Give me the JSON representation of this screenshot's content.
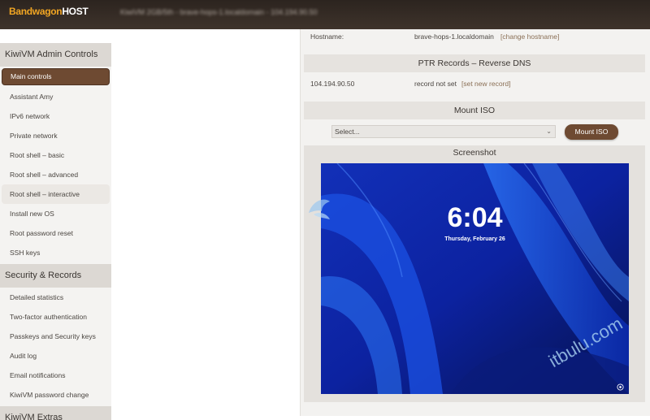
{
  "header": {
    "logo_part1": "Bandwagon",
    "logo_part2": "HOST",
    "server_info": "KiwiVM 2GB/5th - brave-hops-1.localdomain - 104.194.90.50"
  },
  "sidebar": {
    "sections": [
      {
        "title": "KiwiVM Admin Controls",
        "items": [
          "Main controls",
          "Assistant Amy",
          "IPv6 network",
          "Private network",
          "Root shell – basic",
          "Root shell – advanced",
          "Root shell – interactive",
          "Install new OS",
          "Root password reset",
          "SSH keys"
        ]
      },
      {
        "title": "Security & Records",
        "items": [
          "Detailed statistics",
          "Two-factor authentication",
          "Passkeys and Security keys",
          "Audit log",
          "Email notifications",
          "KiwiVM password change"
        ]
      },
      {
        "title": "KiwiVM Extras",
        "items": []
      }
    ],
    "active_item": "Main controls",
    "hovered_item": "Root shell – interactive"
  },
  "main": {
    "hostname_label": "Hostname:",
    "hostname_value": "brave-hops-1.localdomain",
    "change_hostname_link": "[change hostname]",
    "ptr_title": "PTR Records – Reverse DNS",
    "ptr_ip": "104.194.90.50",
    "ptr_status": "record not set",
    "ptr_link": "[set new record]",
    "mount_iso_title": "Mount ISO",
    "iso_select_value": "Select...",
    "mount_iso_button": "Mount ISO",
    "screenshot_title": "Screenshot",
    "lock_time": "6:04",
    "lock_date": "Thursday, February 26"
  },
  "watermark": "itbulu.com",
  "colors": {
    "header_bg": "#2c241f",
    "logo_orange": "#f2a623",
    "accent_brown": "#6e4a32",
    "link": "#8a6f55",
    "screen_blue": "#0a1a8a"
  }
}
